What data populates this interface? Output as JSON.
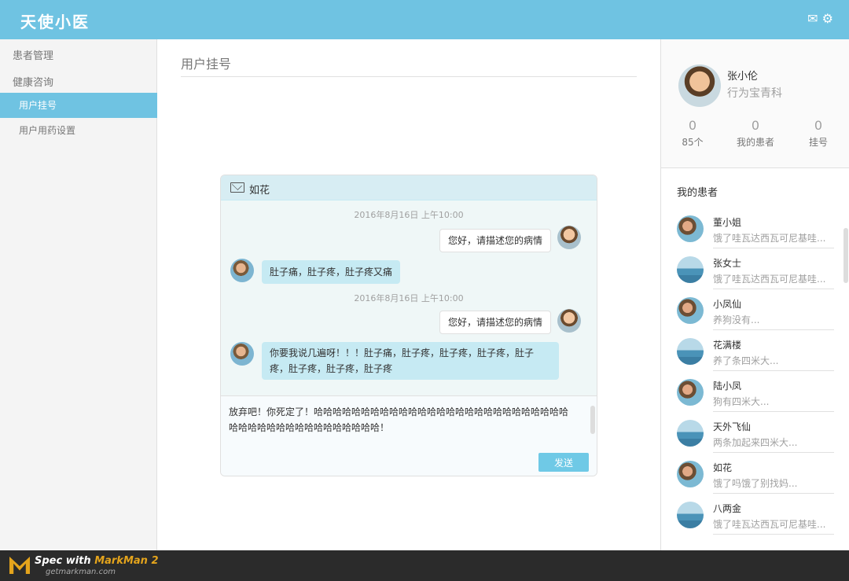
{
  "header": {
    "logo": "天使小医",
    "icons": "✉ ⚙"
  },
  "sidebar": {
    "sections": [
      {
        "label": "患者管理"
      },
      {
        "label": "健康咨询"
      }
    ],
    "items": [
      {
        "label": "用户挂号",
        "active": true
      },
      {
        "label": "用户用药设置",
        "active": false
      }
    ]
  },
  "main": {
    "title": "用户挂号"
  },
  "chat": {
    "patient_name": "如花",
    "timestamps": [
      "2016年8月16日 上午10:00",
      "2016年8月16日 上午10:00"
    ],
    "messages": [
      {
        "from": "doctor",
        "text": "您好，请描述您的病情"
      },
      {
        "from": "patient",
        "text": "肚子痛，肚子疼，肚子疼又痛"
      },
      {
        "from": "doctor",
        "text": "您好，请描述您的病情"
      },
      {
        "from": "patient",
        "text": "你要我说几遍呀！！！肚子痛，肚子疼，肚子疼，肚子疼，肚子疼，肚子疼，肚子疼，肚子疼"
      }
    ],
    "input_text": "放弃吧！你死定了！哈哈哈哈哈哈哈哈哈哈哈哈哈哈哈哈哈哈哈哈哈哈哈哈哈哈哈哈哈哈哈哈哈哈哈哈哈哈哈哈哈哈哈！",
    "send_label": "发送"
  },
  "profile": {
    "name": "张小伦",
    "title": "行为宝青科",
    "stats": [
      {
        "value": "0",
        "label": "85个"
      },
      {
        "value": "0",
        "label": "我的患者"
      },
      {
        "value": "0",
        "label": "挂号"
      }
    ]
  },
  "patients": {
    "title": "我的患者",
    "list": [
      {
        "name": "董小姐",
        "msg": "饿了哇瓦达西瓦可尼基哇...",
        "avatar": "girl"
      },
      {
        "name": "张女士",
        "msg": "饿了哇瓦达西瓦可尼基哇...",
        "avatar": "sea"
      },
      {
        "name": "小凤仙",
        "msg": "养狗没有...",
        "avatar": "girl"
      },
      {
        "name": "花满楼",
        "msg": "养了条四米大...",
        "avatar": "sea"
      },
      {
        "name": "陆小凤",
        "msg": "狗有四米大...",
        "avatar": "girl"
      },
      {
        "name": "天外飞仙",
        "msg": "两条加起来四米大...",
        "avatar": "sea"
      },
      {
        "name": "如花",
        "msg": "饿了吗饿了别找妈...",
        "avatar": "girl"
      },
      {
        "name": "八两金",
        "msg": "饿了哇瓦达西瓦可尼基哇...",
        "avatar": "sea"
      }
    ]
  },
  "footer": {
    "brand_prefix": "Spec with",
    "brand_name": "MarkMan 2",
    "site": "getmarkman.com"
  },
  "colors": {
    "accent": "#6fc3e2",
    "bubble_in": "#c6eaf3",
    "chat_bg": "#eff7f7",
    "border": "#e0e0e0",
    "gray_text": "#a0a0a0"
  }
}
